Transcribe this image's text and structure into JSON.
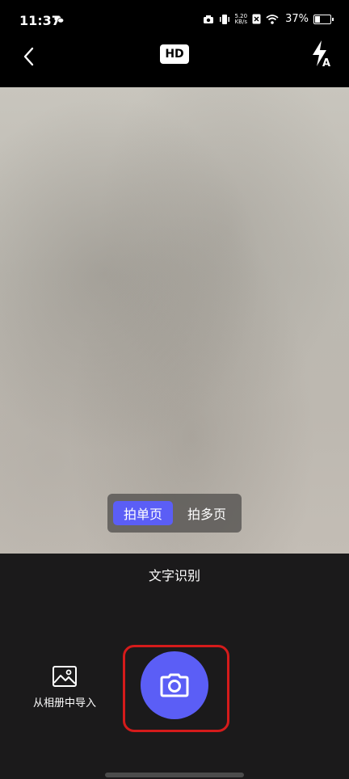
{
  "status": {
    "time": "11:37",
    "net_speed_top": "5.20",
    "net_speed_bottom": "KB/s",
    "battery_percent": "37%",
    "battery_level": 0.37
  },
  "toolbar": {
    "hd_label": "HD"
  },
  "camera": {
    "modes": [
      {
        "label": "拍单页",
        "selected": true
      },
      {
        "label": "拍多页",
        "selected": false
      }
    ],
    "title": "文字识别",
    "import_label": "从相册中导入"
  },
  "colors": {
    "accent": "#5b5ef6",
    "highlight": "#d51b1b"
  }
}
